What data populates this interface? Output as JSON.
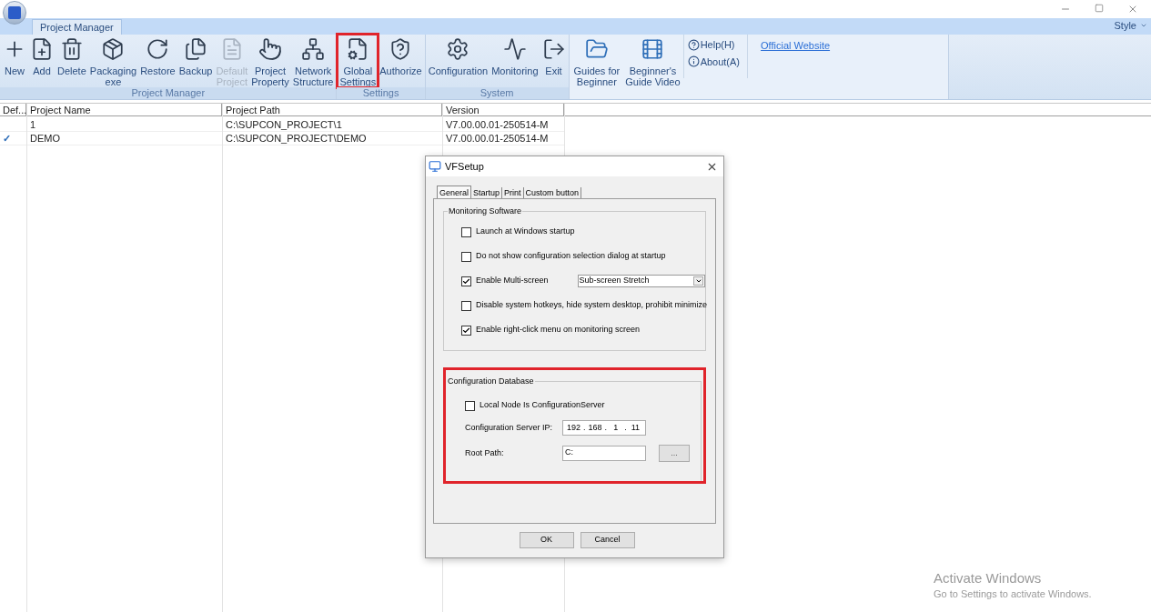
{
  "ribbon": {
    "tabs": [
      {
        "label": "Project Manager",
        "selected": true
      }
    ],
    "style_menu": "Style",
    "groups": [
      {
        "label": "Project Manager",
        "buttons": [
          {
            "lines": [
              "New"
            ],
            "disabled": false,
            "highlighted": false
          },
          {
            "lines": [
              "Add"
            ],
            "disabled": false,
            "highlighted": false
          },
          {
            "lines": [
              "Delete"
            ],
            "disabled": false,
            "highlighted": false
          },
          {
            "lines": [
              "Packaging",
              "exe"
            ],
            "disabled": false,
            "highlighted": false
          },
          {
            "lines": [
              "Restore"
            ],
            "disabled": false,
            "highlighted": false
          },
          {
            "lines": [
              "Backup"
            ],
            "disabled": false,
            "highlighted": false
          },
          {
            "lines": [
              "Default",
              "Project"
            ],
            "disabled": true,
            "highlighted": false
          },
          {
            "lines": [
              "Project",
              "Property"
            ],
            "disabled": false,
            "highlighted": false
          },
          {
            "lines": [
              "Network",
              "Structure"
            ],
            "disabled": false,
            "highlighted": false
          }
        ]
      },
      {
        "label": "Settings",
        "buttons": [
          {
            "lines": [
              "Global",
              "Settings"
            ],
            "disabled": false,
            "highlighted": true
          },
          {
            "lines": [
              "Authorize"
            ],
            "disabled": false,
            "highlighted": false
          }
        ]
      },
      {
        "label": "System",
        "buttons": [
          {
            "lines": [
              "Configuration"
            ],
            "disabled": false,
            "highlighted": false
          },
          {
            "lines": [
              "Monitoring"
            ],
            "disabled": false,
            "highlighted": false
          },
          {
            "lines": [
              "Exit"
            ],
            "disabled": false,
            "highlighted": false
          }
        ]
      }
    ],
    "guides": [
      {
        "lines": [
          "Guides for",
          "Beginner"
        ]
      },
      {
        "lines": [
          "Beginner's",
          "Guide Video"
        ]
      }
    ],
    "help_links": [
      {
        "label": "Help(H)"
      },
      {
        "label": "About(A)"
      }
    ],
    "official_website": "Official Website"
  },
  "table": {
    "columns": [
      "Def...",
      "Project Name",
      "Project Path",
      "Version"
    ],
    "rows": [
      {
        "cells": [
          "",
          "1",
          "C:\\SUPCON_PROJECT\\1",
          "V7.00.00.01-250514-M"
        ]
      },
      {
        "cells": [
          "✓",
          "DEMO",
          "C:\\SUPCON_PROJECT\\DEMO",
          "V7.00.00.01-250514-M"
        ]
      }
    ]
  },
  "dialog": {
    "title": "VFSetup",
    "tabs": [
      {
        "label": "General",
        "selected": true
      },
      {
        "label": "Startup",
        "selected": false
      },
      {
        "label": "Print",
        "selected": false
      },
      {
        "label": "Custom button",
        "selected": false
      }
    ],
    "monitoring": {
      "title": "Monitoring Software",
      "options": [
        {
          "label": "Launch at Windows startup",
          "checked": false
        },
        {
          "label": "Do not show configuration selection dialog at startup",
          "checked": false
        },
        {
          "label": "Enable Multi-screen",
          "checked": true,
          "select": "Sub-screen Stretch"
        },
        {
          "label": "Disable system hotkeys, hide system desktop, prohibit minimize",
          "checked": false
        },
        {
          "label": "Enable right-click menu on monitoring screen",
          "checked": true
        }
      ]
    },
    "database": {
      "title": "Configuration Database",
      "highlighted": true,
      "local_node": {
        "label": "Local Node Is ConfigurationServer",
        "checked": false
      },
      "server_ip": {
        "label": "Configuration Server IP:",
        "octets": [
          "192",
          "168",
          "1",
          "11"
        ],
        "separator": "."
      },
      "root_path": {
        "label": "Root Path:",
        "value": "C:",
        "browse": "..."
      }
    },
    "buttons": [
      "OK",
      "Cancel"
    ]
  },
  "os_notice": {
    "title": "Activate Windows",
    "text": "Go to Settings to activate Windows."
  }
}
